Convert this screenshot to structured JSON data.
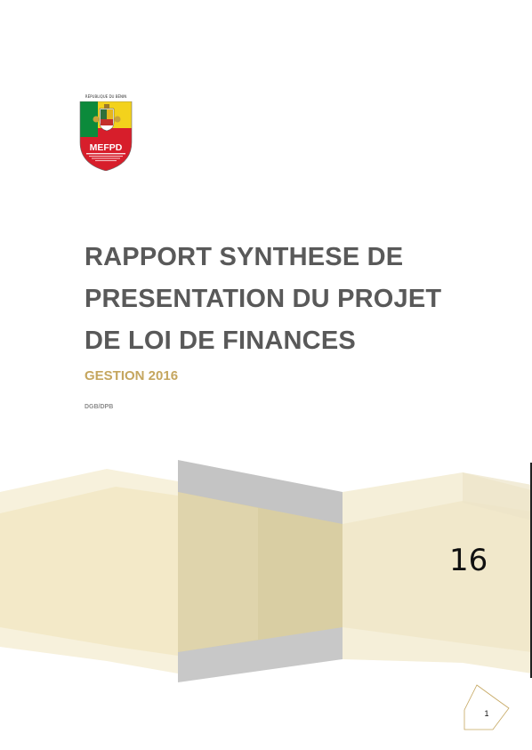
{
  "logo": {
    "top_text": "RÉPUBLIQUE DU BÉNIN",
    "acronym": "MEFPD",
    "colors": {
      "green": "#0b8a3b",
      "yellow": "#f3d21c",
      "red": "#d71e2b"
    }
  },
  "document": {
    "title_lines": [
      "RAPPORT SYNTHESE DE",
      "PRESENTATION DU PROJET",
      "DE LOI DE FINANCES"
    ],
    "subtitle": "GESTION 2016",
    "department": "DGB/DPB",
    "year_short": "16",
    "page_number": "1"
  },
  "colors": {
    "title": "#595959",
    "subtitle": "#c5a65f",
    "band_gold": "#d8cda2",
    "band_cream": "#f6efd6",
    "band_gray": "#bfbfbf"
  }
}
